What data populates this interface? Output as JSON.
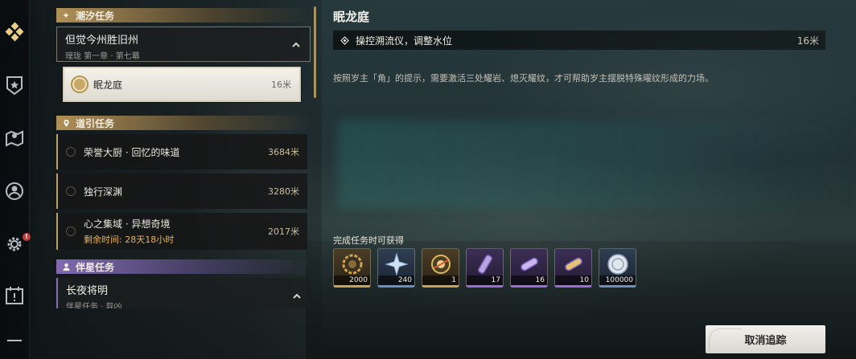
{
  "rail": {
    "items": [
      {
        "icon": "quest-diamond-icon",
        "active": true
      },
      {
        "icon": "badge-shield-icon",
        "active": false
      },
      {
        "icon": "map-pin-icon",
        "active": false
      },
      {
        "icon": "person-circle-icon",
        "active": false
      },
      {
        "icon": "gear-icon",
        "active": false,
        "alert": "!"
      },
      {
        "icon": "calendar-icon",
        "active": false
      }
    ]
  },
  "categories": {
    "tide": {
      "label": "潮汐任务",
      "icon": "star-sparkle-icon"
    },
    "guide": {
      "label": "道引任务",
      "icon": "location-pin-icon"
    },
    "companion": {
      "label": "伴星任务",
      "icon": "person-icon"
    }
  },
  "tide_chapter": {
    "title": "但觉今州胜旧州",
    "subtitle": "瑝珑 第一章 · 第七幕"
  },
  "active_quest": {
    "name": "眠龙庭",
    "distance": "16米"
  },
  "guide_quests": [
    {
      "name": "荣誉大厨 · 回忆的味道",
      "distance": "3684米"
    },
    {
      "name": "独行深渊",
      "distance": "3280米"
    },
    {
      "name": "心之集域 · 异想奇境",
      "distance": "2017米",
      "remaining": "剩余时间: 28天18小时"
    }
  ],
  "companion_chapter": {
    "title": "长夜将明",
    "subtitle": "伴星任务 · 异凶"
  },
  "detail": {
    "title": "眠龙庭",
    "objective": "操控溯流仪，调整水位",
    "objective_distance": "16米",
    "description": "按照岁主「角」的提示，需要激活三处耀岩、熄灭耀纹，才可帮助岁主摆脱特殊曜纹形成的力场。"
  },
  "rewards": {
    "title": "完成任务时可获得",
    "items": [
      {
        "icon": "gear-coin-icon",
        "count": "2000",
        "rarity": "gold"
      },
      {
        "icon": "crystal-star-icon",
        "count": "240",
        "rarity": "blue"
      },
      {
        "icon": "golden-orb-icon",
        "count": "1",
        "rarity": "gold"
      },
      {
        "icon": "purple-vial-icon",
        "count": "17",
        "rarity": "purple"
      },
      {
        "icon": "purple-capsule-icon",
        "count": "16",
        "rarity": "purple"
      },
      {
        "icon": "gold-capsule-icon",
        "count": "10",
        "rarity": "purple"
      },
      {
        "icon": "shell-coin-icon",
        "count": "100000",
        "rarity": "blue"
      }
    ]
  },
  "actions": {
    "untrack_label": "取消追踪"
  },
  "colors": {
    "accent_gold": "#b9a06a",
    "companion_purple": "#876eb9",
    "timer_orange": "#e7b45a"
  }
}
